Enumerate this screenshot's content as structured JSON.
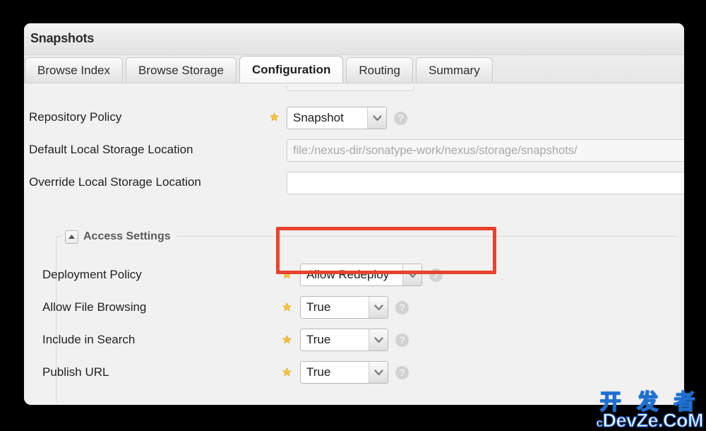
{
  "panel": {
    "title": "Snapshots"
  },
  "tabs": [
    {
      "label": "Browse Index",
      "active": false
    },
    {
      "label": "Browse Storage",
      "active": false
    },
    {
      "label": "Configuration",
      "active": true
    },
    {
      "label": "Routing",
      "active": false
    },
    {
      "label": "Summary",
      "active": false
    }
  ],
  "form": {
    "repository_policy": {
      "label": "Repository Policy",
      "value": "Snapshot",
      "required_marker": "star-icon",
      "help": "?"
    },
    "default_local_storage_location": {
      "label": "Default Local Storage Location",
      "value": "file:/nexus-dir/sonatype-work/nexus/storage/snapshots/",
      "readonly": true
    },
    "override_local_storage_location": {
      "label": "Override Local Storage Location",
      "value": "",
      "placeholder": ""
    }
  },
  "access_settings": {
    "legend": "Access Settings",
    "toggle_icon": "collapse-up-arrow-icon",
    "rows": [
      {
        "label": "Deployment Policy",
        "value": "Allow Redeploy",
        "highlighted": true,
        "required_marker": "star-icon",
        "help": "?"
      },
      {
        "label": "Allow File Browsing",
        "value": "True",
        "highlighted": false,
        "required_marker": "star-icon",
        "help": "?"
      },
      {
        "label": "Include in Search",
        "value": "True",
        "highlighted": false,
        "required_marker": "star-icon",
        "help": "?"
      },
      {
        "label": "Publish URL",
        "value": "True",
        "highlighted": false,
        "required_marker": "star-icon",
        "help": "?"
      }
    ]
  },
  "annotation": {
    "type": "red-highlight-rectangle",
    "target": "Deployment Policy",
    "color": "#e8422c"
  },
  "watermark": {
    "chinese": "开 发 者",
    "latin_prefix": "c",
    "latin": "DevZe.CoM",
    "color": "#1f6fd0"
  }
}
